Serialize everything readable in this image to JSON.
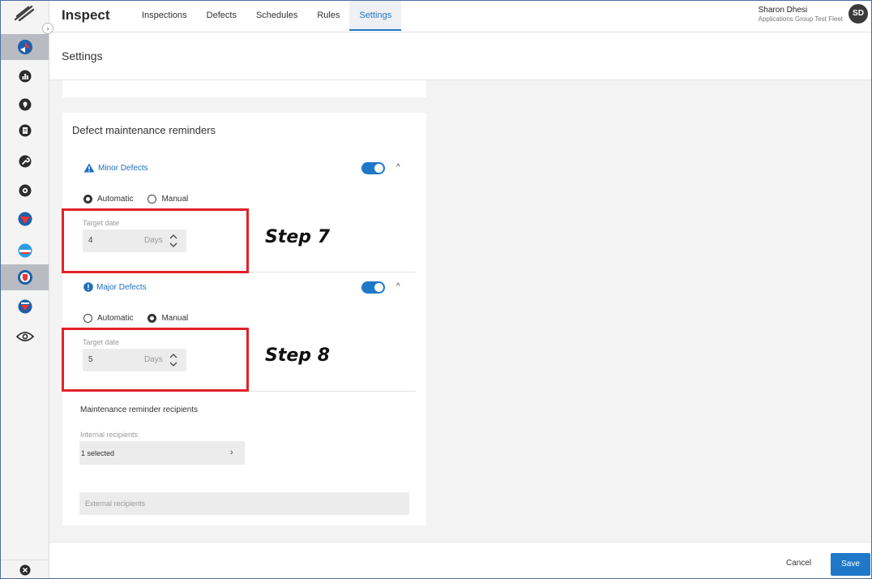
{
  "app": {
    "title": "Inspect"
  },
  "nav": {
    "tabs": [
      {
        "label": "Inspections"
      },
      {
        "label": "Defects"
      },
      {
        "label": "Schedules"
      },
      {
        "label": "Rules"
      },
      {
        "label": "Settings",
        "active": true
      }
    ]
  },
  "user": {
    "name": "Sharon Dhesi",
    "org": "Applications Group Test Fleet",
    "initials": "SD"
  },
  "sidebar": {
    "icons": [
      "app-logo-icon",
      "expand-chevron-icon",
      "module-1-icon",
      "dashboard-icon",
      "location-icon",
      "document-icon",
      "wrench-icon",
      "settings-icon",
      "module-2-icon",
      "module-3-icon",
      "inspect-module-icon",
      "module-4-icon",
      "eye-icon",
      "close-icon"
    ],
    "active_index": 10
  },
  "page": {
    "title": "Settings"
  },
  "card": {
    "title": "Defect maintenance reminders",
    "minor": {
      "label": "Minor Defects",
      "enabled": true,
      "mode_options": [
        "Automatic",
        "Manual"
      ],
      "selected_mode": "Automatic",
      "target_label": "Target date",
      "target_value": "4",
      "unit": "Days"
    },
    "major": {
      "label": "Major Defects",
      "enabled": true,
      "mode_options": [
        "Automatic",
        "Manual"
      ],
      "selected_mode": "Manual",
      "target_label": "Target date",
      "target_value": "5",
      "unit": "Days"
    },
    "recipients": {
      "title": "Maintenance reminder recipients",
      "internal_label": "Internal recipients",
      "internal_value": "1 selected",
      "external_placeholder": "External recipients"
    }
  },
  "annotations": {
    "step7": "Step 7",
    "step8": "Step 8"
  },
  "footer": {
    "cancel": "Cancel",
    "save": "Save"
  },
  "colors": {
    "accent": "#1f78c8",
    "annotation": "#e2222a"
  }
}
